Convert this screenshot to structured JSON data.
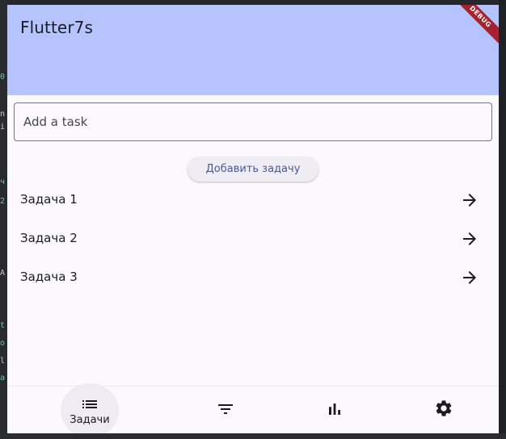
{
  "app": {
    "title": "Flutter7s",
    "debug_banner": "DEBUG"
  },
  "input": {
    "placeholder": "Add a task",
    "value": ""
  },
  "add_button": {
    "label": "Добавить задачу"
  },
  "tasks": [
    {
      "label": "Задача 1",
      "icon": "arrow-forward-icon"
    },
    {
      "label": "Задача 2",
      "icon": "arrow-forward-icon"
    },
    {
      "label": "Задача 3",
      "icon": "arrow-forward-icon"
    }
  ],
  "bottom_nav": {
    "items": [
      {
        "icon": "list-icon",
        "label": "Задачи",
        "selected": true
      },
      {
        "icon": "filter-icon",
        "label": "",
        "selected": false
      },
      {
        "icon": "bar-chart-icon",
        "label": "",
        "selected": false
      },
      {
        "icon": "gear-icon",
        "label": "",
        "selected": false
      }
    ]
  },
  "colors": {
    "appbar": "#b5c3fe",
    "surface": "#fbf8fe",
    "button_text": "#485a8f",
    "debug_banner": "#a3232e"
  }
}
